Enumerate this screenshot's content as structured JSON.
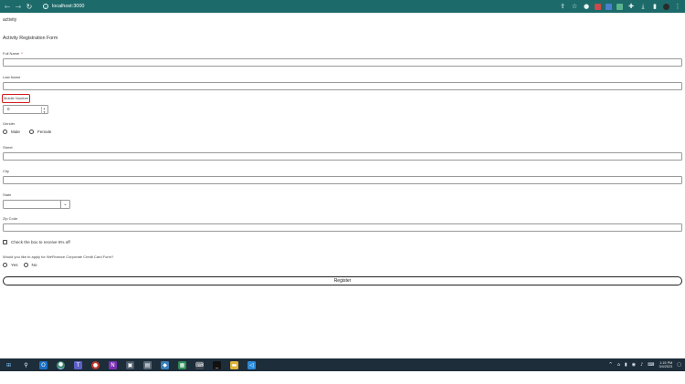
{
  "browser": {
    "url": "localhost:3000",
    "back_icon": "arrow-left-icon",
    "forward_icon": "arrow-right-icon",
    "reload_icon": "reload-icon"
  },
  "app": {
    "title": "activity"
  },
  "form": {
    "title": "Activity Registration Form",
    "full_name_label": "Full Name",
    "required_mark": "*",
    "last_name_label": "Last Name",
    "mobile_label": "Mobile Number",
    "mobile_value": "0",
    "gender_label": "Gender",
    "gender_options": [
      "Male",
      "Female"
    ],
    "street_label": "Street",
    "city_label": "City",
    "state_label": "State",
    "zip_label": "Zip Code",
    "discount_label": "Check the box to receive 5% off",
    "credit_question": "Would you like to apply for WeFinance Corporate Credit Card Form?",
    "credit_options": [
      "Yes",
      "No"
    ],
    "register_label": "Register"
  },
  "taskbar": {
    "time": "1:15 PM",
    "date": "3/4/2023"
  },
  "colors": {
    "chrome": "#1d6a6a",
    "taskbar": "#1e2d3a",
    "highlight": "#d31a1a"
  }
}
